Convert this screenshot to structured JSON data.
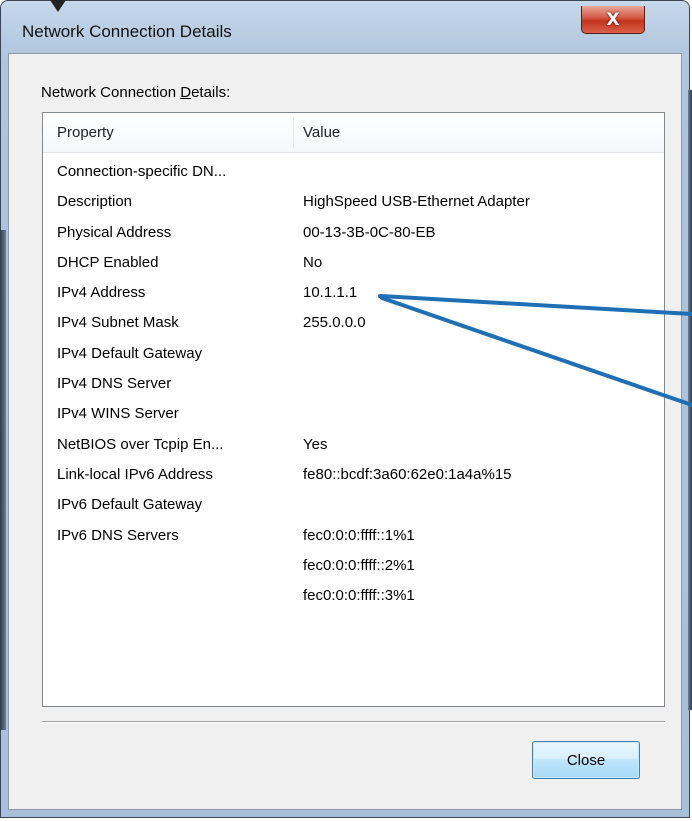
{
  "window": {
    "title": "Network Connection Details"
  },
  "titlebar": {
    "close_glyph": "X"
  },
  "section": {
    "label_pre": "Network Connection ",
    "label_accel": "D",
    "label_post": "etails:"
  },
  "list": {
    "columns": [
      "Property",
      "Value"
    ],
    "rows": [
      {
        "property": "Connection-specific DN...",
        "value": ""
      },
      {
        "property": "Description",
        "value": "HighSpeed USB-Ethernet Adapter"
      },
      {
        "property": "Physical Address",
        "value": "00-13-3B-0C-80-EB"
      },
      {
        "property": "DHCP Enabled",
        "value": "No"
      },
      {
        "property": "IPv4 Address",
        "value": "10.1.1.1"
      },
      {
        "property": "IPv4 Subnet Mask",
        "value": "255.0.0.0"
      },
      {
        "property": "IPv4 Default Gateway",
        "value": ""
      },
      {
        "property": "IPv4 DNS Server",
        "value": ""
      },
      {
        "property": "IPv4 WINS Server",
        "value": ""
      },
      {
        "property": "NetBIOS over Tcpip En...",
        "value": "Yes"
      },
      {
        "property": "Link-local IPv6 Address",
        "value": "fe80::bcdf:3a60:62e0:1a4a%15"
      },
      {
        "property": "IPv6 Default Gateway",
        "value": ""
      },
      {
        "property": "IPv6 DNS Servers",
        "value": "fec0:0:0:ffff::1%1"
      },
      {
        "property": "",
        "value": "fec0:0:0:ffff::2%1"
      },
      {
        "property": "",
        "value": "fec0:0:0:ffff::3%1"
      }
    ]
  },
  "footer": {
    "close_label": "Close"
  },
  "colors": {
    "annotation_arrow": "#1f6fb5"
  }
}
